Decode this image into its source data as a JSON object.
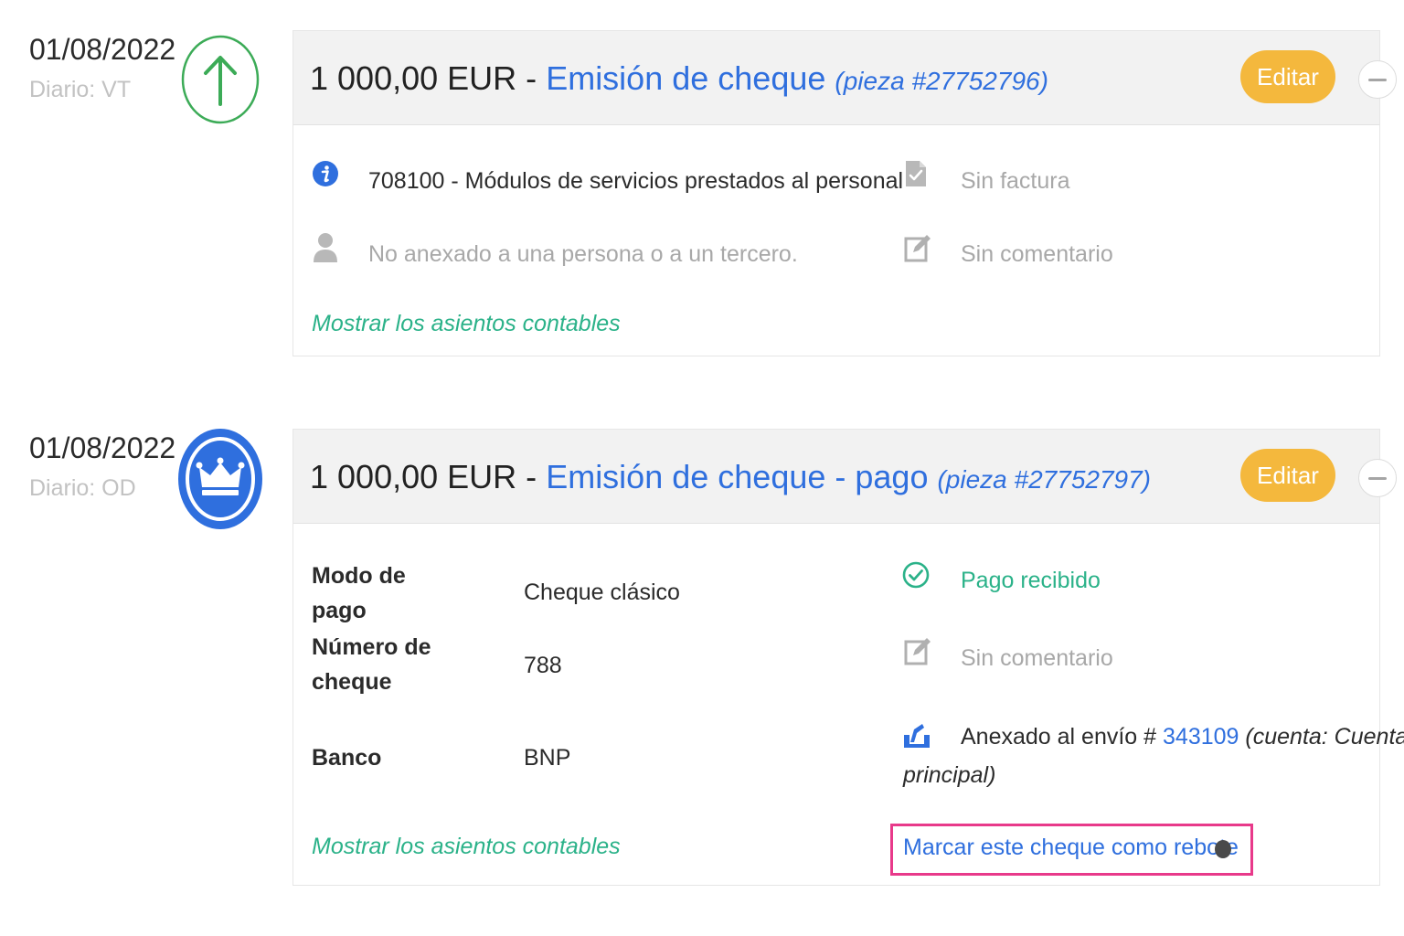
{
  "entries": [
    {
      "date": "01/08/2022",
      "journal": "Diario: VT",
      "status_icon": "arrow-up-icon",
      "amount": "1 000,00 EUR",
      "separator": "-",
      "operation": "Emisión de cheque",
      "piece": "(pieza #27752796)",
      "edit_label": "Editar",
      "account": "708100 - Módulos de servicios prestados al personal",
      "person": "No anexado a una persona o a un tercero.",
      "invoice": "Sin factura",
      "comment": "Sin comentario",
      "show_entries": "Mostrar los asientos contables"
    },
    {
      "date": "01/08/2022",
      "journal": "Diario: OD",
      "status_icon": "crown-icon",
      "amount": "1 000,00 EUR",
      "separator": "-",
      "operation": "Emisión de cheque - pago",
      "piece": "(pieza #27752797)",
      "edit_label": "Editar",
      "payment_mode_label_line1": "Modo de",
      "payment_mode_label_line2": "pago",
      "payment_mode_value": "Cheque clásico",
      "check_number_label_line1": "Número de",
      "check_number_label_line2": "cheque",
      "check_number_value": "788",
      "bank_label": "Banco",
      "bank_value": "BNP",
      "payment_status": "Pago recibido",
      "comment": "Sin comentario",
      "shipment_prefix": "Anexado al envío #",
      "shipment_number": "343109",
      "shipment_account_line1": "(cuenta: Cuenta",
      "shipment_account_line2": "principal)",
      "show_entries": "Mostrar los asientos contables",
      "bounce_action": "Marcar este cheque como rebote"
    }
  ],
  "colors": {
    "accent_blue": "#2f6fde",
    "green": "#2bb289",
    "edit_button": "#f4b83d",
    "highlight": "#e8398a"
  }
}
